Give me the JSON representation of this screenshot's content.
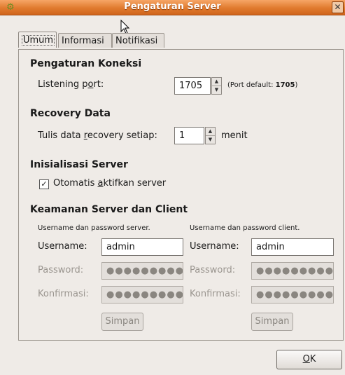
{
  "window": {
    "title": "Pengaturan Server",
    "close_glyph": "✕",
    "app_icon": "gear-wrench-icon"
  },
  "tabs": [
    {
      "label": "Umum",
      "active": true
    },
    {
      "label": "Informasi",
      "active": false
    },
    {
      "label": "Notifikasi",
      "active": false
    }
  ],
  "koneksi": {
    "heading": "Pengaturan Koneksi",
    "port_label_pre": "Listening p",
    "port_label_mn": "o",
    "port_label_post": "rt:",
    "port_value": "1705",
    "port_default_pre": "(Port default: ",
    "port_default_value": "1705",
    "port_default_post": ")"
  },
  "recovery": {
    "heading": "Recovery Data",
    "label_pre": "Tulis data ",
    "label_mn": "r",
    "label_post": "ecovery setiap:",
    "value": "1",
    "unit": "menit"
  },
  "inisialisasi": {
    "heading": "Inisialisasi Server",
    "checkbox_checked": true,
    "check_glyph": "✓",
    "checkbox_pre": "Otomatis ",
    "checkbox_mn": "a",
    "checkbox_post": "ktifkan server"
  },
  "keamanan": {
    "heading": "Keamanan Server dan Client",
    "server": {
      "caption": "Username dan password server.",
      "username_label": "Username:",
      "username_value": "admin",
      "password_label": "Password:",
      "password_mask": "●●●●●●●●●●",
      "confirm_label": "Konfirmasi:",
      "confirm_mask": "●●●●●●●●●●",
      "save_label": "Simpan"
    },
    "client": {
      "caption": "Username dan password client.",
      "username_label": "Username:",
      "username_value": "admin",
      "password_label": "Password:",
      "password_mask": "●●●●●●●●●●",
      "confirm_label": "Konfirmasi:",
      "confirm_mask": "●●●●●●●●●●",
      "save_label": "Simpan"
    }
  },
  "footer": {
    "ok_mn": "O",
    "ok_post": "K"
  }
}
